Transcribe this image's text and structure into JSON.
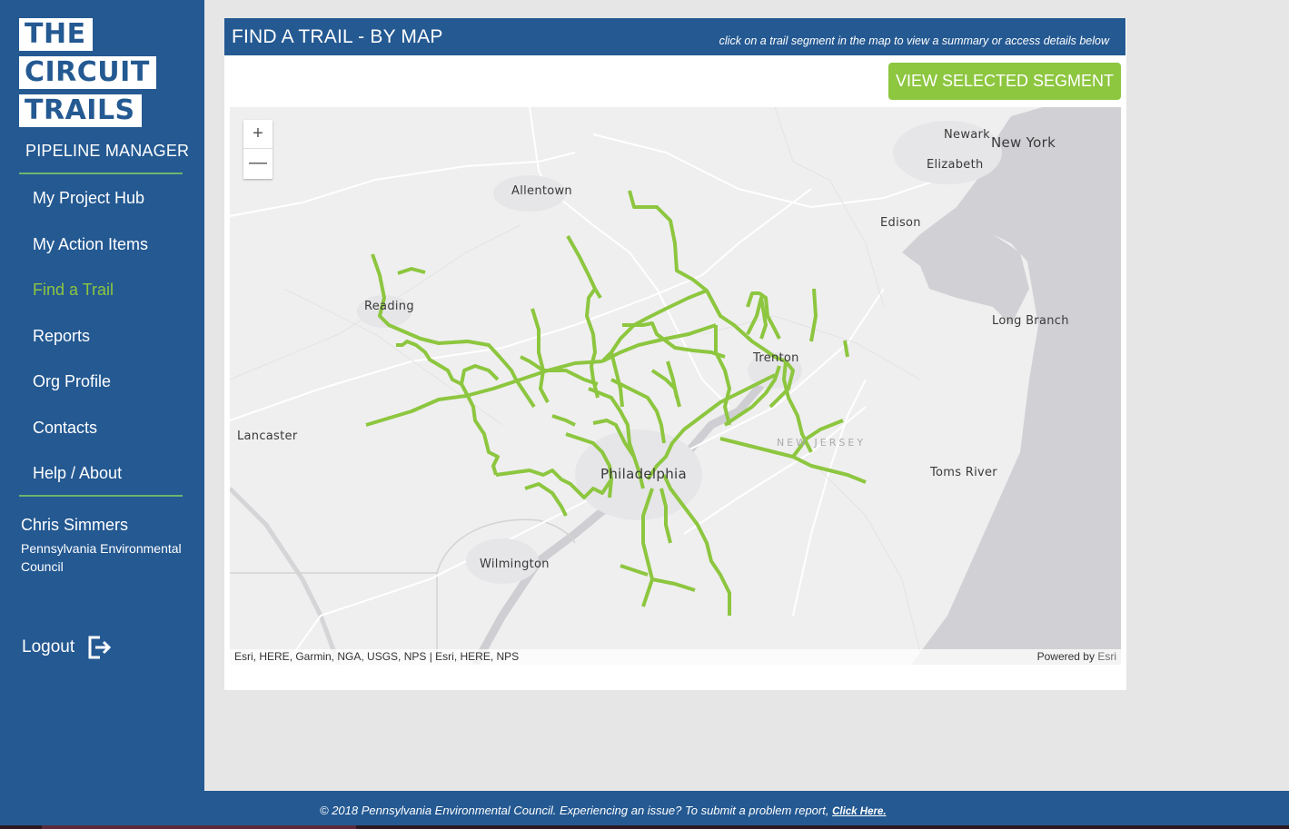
{
  "sidebar": {
    "logo_lines": [
      "THE",
      "CIRCUIT",
      "TRAILS"
    ],
    "app_name": "PIPELINE MANAGER",
    "nav": [
      {
        "label": "My Project Hub",
        "active": false
      },
      {
        "label": "My Action Items",
        "active": false
      },
      {
        "label": "Find a Trail",
        "active": true
      },
      {
        "label": "Reports",
        "active": false
      },
      {
        "label": "Org Profile",
        "active": false
      },
      {
        "label": "Contacts",
        "active": false
      },
      {
        "label": "Help / About",
        "active": false
      }
    ],
    "user": {
      "name": "Chris Simmers",
      "organization": "Pennsylvania Environmental Council"
    },
    "logout_label": "Logout",
    "logout_icon": "logout-icon"
  },
  "panel": {
    "title": "FIND A TRAIL - BY MAP",
    "hint": "click on a trail segment in the map to view a summary or access details below",
    "view_button_label": "VIEW SELECTED SEGMENT"
  },
  "map": {
    "zoom_in_label": "+",
    "zoom_out_label": "—",
    "cities": [
      {
        "name": "Allentown"
      },
      {
        "name": "Newark"
      },
      {
        "name": "New York"
      },
      {
        "name": "Elizabeth"
      },
      {
        "name": "Edison"
      },
      {
        "name": "Reading"
      },
      {
        "name": "Long Branch"
      },
      {
        "name": "Trenton"
      },
      {
        "name": "Lancaster"
      },
      {
        "name": "Philadelphia"
      },
      {
        "name": "Toms River"
      },
      {
        "name": "Wilmington"
      }
    ],
    "state_label": "NEW JERSEY",
    "attribution": "Esri, HERE, Garmin, NGA, USGS, NPS | Esri, HERE, NPS",
    "powered_by": "Powered by",
    "powered_by_brand": "Esri",
    "trail_color": "#8dc63f"
  },
  "footer": {
    "text": "© 2018 Pennsylvania Environmental Council. Experiencing an issue?  To submit a problem report,",
    "link_label": "Click Here."
  },
  "colors": {
    "brand_blue": "#245992",
    "accent_green": "#8dc63f",
    "divider_green": "#6cb56e"
  }
}
